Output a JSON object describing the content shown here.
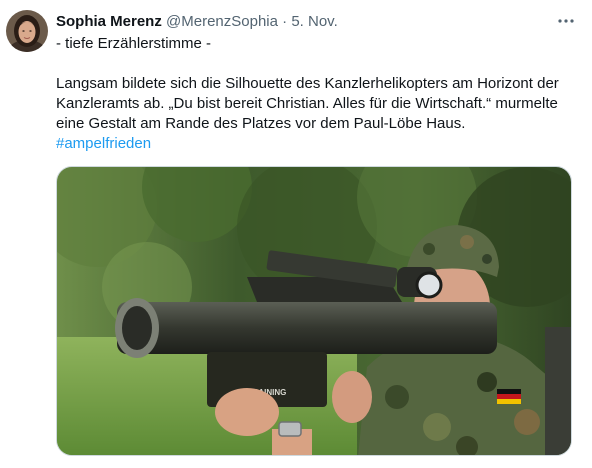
{
  "author": {
    "name": "Sophia Merenz",
    "handle": "@MerenzSophia",
    "separator": "·",
    "date": "5. Nov."
  },
  "tweet": {
    "line1": "- tiefe Erzählerstimme -",
    "paragraph": "Langsam bildete sich die Silhouette des Kanzlerhelikopters am Horizont der Kanzleramts ab. „Du bist bereit Christian. Alles für die Wirtschaft.“ murmelte eine Gestalt am Rande des Platzes vor dem Paul-Löbe Haus.",
    "hashtag": "#ampelfrieden"
  },
  "media": {
    "weapon_label": "TRAINING"
  },
  "icons": {
    "more": "more-horizontal-icon",
    "avatar": "avatar"
  },
  "colors": {
    "text": "#0f1419",
    "secondary": "#536471",
    "link": "#1d9bf0",
    "border": "#cfd9de"
  }
}
